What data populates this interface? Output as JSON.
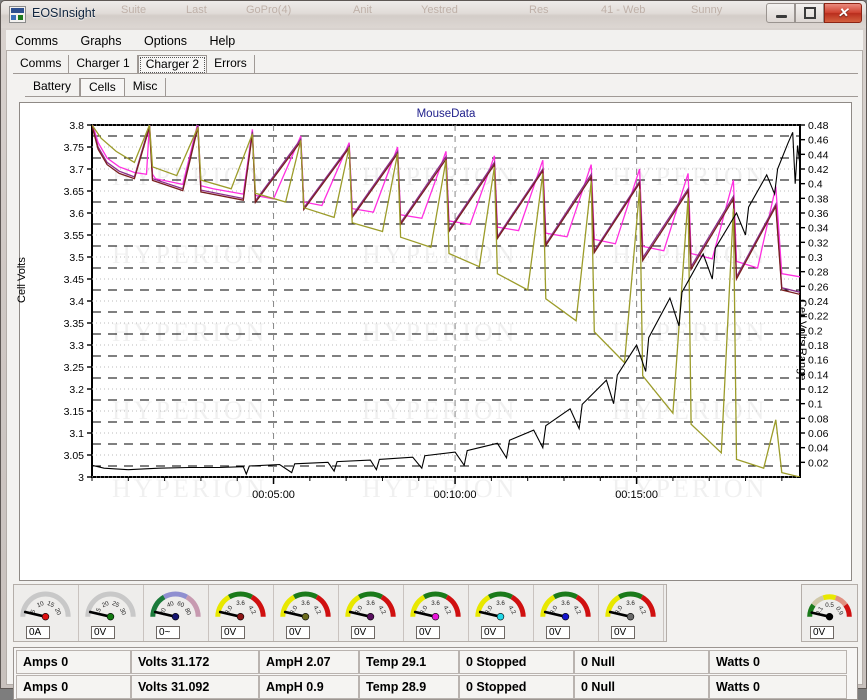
{
  "window": {
    "title": "EOSInsight",
    "ghost_labels": [
      "Suite",
      "Last",
      "GoPro(4)",
      "Anit",
      "Yestred",
      "Res",
      "41 - Web",
      "Sunny"
    ],
    "buttons": {
      "minimize": "minimize-button",
      "maximize": "maximize-button",
      "close": "✕"
    }
  },
  "menu": {
    "items": [
      "Comms",
      "Graphs",
      "Options",
      "Help"
    ]
  },
  "tabs_primary": {
    "items": [
      "Comms",
      "Charger 1",
      "Charger 2",
      "Errors"
    ],
    "selected": "Charger 2"
  },
  "tabs_secondary": {
    "items": [
      "Battery",
      "Cells",
      "Misc"
    ],
    "selected": "Cells"
  },
  "chart_data": {
    "type": "line",
    "title": "MouseData",
    "xlabel": "",
    "ylabel": "Cell Volts",
    "y2label": "Cell Volts Range",
    "ylim": [
      3,
      3.8
    ],
    "y2lim": [
      0,
      0.48
    ],
    "xlim": [
      0,
      1170
    ],
    "grid": true,
    "legend_position": "none",
    "watermark": "HYPERION",
    "xtick_labels": [
      "00:05:00",
      "00:10:00",
      "00:15:00"
    ],
    "xtick_values": [
      300,
      600,
      900
    ],
    "ytick_labels": [
      "3",
      "3.05",
      "3.1",
      "3.15",
      "3.2",
      "3.25",
      "3.3",
      "3.35",
      "3.4",
      "3.45",
      "3.5",
      "3.55",
      "3.6",
      "3.65",
      "3.7",
      "3.75",
      "3.8"
    ],
    "y2tick_labels": [
      "0.02",
      "0.04",
      "0.06",
      "0.08",
      "0.1",
      "0.12",
      "0.14",
      "0.16",
      "0.18",
      "0.2",
      "0.22",
      "0.24",
      "0.26",
      "0.28",
      "0.3",
      "0.32",
      "0.34",
      "0.36",
      "0.38",
      "0.4",
      "0.42",
      "0.44",
      "0.46",
      "0.48"
    ],
    "series": [
      {
        "name": "Cell Volts (magenta)",
        "color": "#ff2fe0",
        "axis": "left",
        "points": [
          [
            0,
            3.805
          ],
          [
            10,
            3.76
          ],
          [
            25,
            3.725
          ],
          [
            45,
            3.705
          ],
          [
            70,
            3.692
          ],
          [
            90,
            3.688
          ],
          [
            95,
            3.805
          ],
          [
            100,
            3.688
          ],
          [
            105,
            3.678
          ],
          [
            150,
            3.665
          ],
          [
            175,
            3.805
          ],
          [
            180,
            3.662
          ],
          [
            200,
            3.655
          ],
          [
            250,
            3.643
          ],
          [
            265,
            3.79
          ],
          [
            270,
            3.64
          ],
          [
            300,
            3.632
          ],
          [
            345,
            3.775
          ],
          [
            350,
            3.625
          ],
          [
            380,
            3.617
          ],
          [
            425,
            3.76
          ],
          [
            430,
            3.61
          ],
          [
            465,
            3.602
          ],
          [
            505,
            3.75
          ],
          [
            510,
            3.596
          ],
          [
            545,
            3.588
          ],
          [
            585,
            3.74
          ],
          [
            590,
            3.582
          ],
          [
            625,
            3.574
          ],
          [
            665,
            3.73
          ],
          [
            670,
            3.568
          ],
          [
            705,
            3.56
          ],
          [
            745,
            3.72
          ],
          [
            750,
            3.554
          ],
          [
            785,
            3.546
          ],
          [
            825,
            3.71
          ],
          [
            830,
            3.54
          ],
          [
            865,
            3.53
          ],
          [
            905,
            3.7
          ],
          [
            910,
            3.524
          ],
          [
            945,
            3.514
          ],
          [
            985,
            3.69
          ],
          [
            990,
            3.508
          ],
          [
            1025,
            3.496
          ],
          [
            1060,
            3.675
          ],
          [
            1065,
            3.49
          ],
          [
            1100,
            3.475
          ],
          [
            1130,
            3.66
          ],
          [
            1140,
            3.462
          ],
          [
            1170,
            3.455
          ]
        ]
      },
      {
        "name": "Cell Volts (purple)",
        "color": "#8b2f8b",
        "axis": "left",
        "points": [
          [
            0,
            3.8
          ],
          [
            10,
            3.75
          ],
          [
            25,
            3.715
          ],
          [
            45,
            3.695
          ],
          [
            70,
            3.682
          ],
          [
            95,
            3.8
          ],
          [
            100,
            3.678
          ],
          [
            150,
            3.655
          ],
          [
            175,
            3.8
          ],
          [
            180,
            3.652
          ],
          [
            250,
            3.633
          ],
          [
            265,
            3.785
          ],
          [
            270,
            3.628
          ],
          [
            345,
            3.768
          ],
          [
            350,
            3.612
          ],
          [
            425,
            3.752
          ],
          [
            430,
            3.594
          ],
          [
            505,
            3.74
          ],
          [
            510,
            3.578
          ],
          [
            585,
            3.728
          ],
          [
            590,
            3.562
          ],
          [
            665,
            3.715
          ],
          [
            670,
            3.546
          ],
          [
            745,
            3.7
          ],
          [
            750,
            3.53
          ],
          [
            825,
            3.688
          ],
          [
            830,
            3.514
          ],
          [
            905,
            3.672
          ],
          [
            910,
            3.498
          ],
          [
            985,
            3.655
          ],
          [
            990,
            3.478
          ],
          [
            1060,
            3.638
          ],
          [
            1065,
            3.455
          ],
          [
            1130,
            3.62
          ],
          [
            1140,
            3.43
          ],
          [
            1170,
            3.42
          ]
        ]
      },
      {
        "name": "Cell Volts (dark red)",
        "color": "#7a2020",
        "axis": "left",
        "points": [
          [
            0,
            3.798
          ],
          [
            10,
            3.745
          ],
          [
            25,
            3.71
          ],
          [
            45,
            3.69
          ],
          [
            70,
            3.678
          ],
          [
            95,
            3.795
          ],
          [
            100,
            3.674
          ],
          [
            150,
            3.651
          ],
          [
            175,
            3.795
          ],
          [
            180,
            3.648
          ],
          [
            250,
            3.629
          ],
          [
            265,
            3.78
          ],
          [
            270,
            3.624
          ],
          [
            345,
            3.763
          ],
          [
            350,
            3.608
          ],
          [
            425,
            3.748
          ],
          [
            430,
            3.59
          ],
          [
            505,
            3.735
          ],
          [
            510,
            3.574
          ],
          [
            585,
            3.722
          ],
          [
            590,
            3.558
          ],
          [
            665,
            3.71
          ],
          [
            670,
            3.542
          ],
          [
            745,
            3.696
          ],
          [
            750,
            3.526
          ],
          [
            825,
            3.682
          ],
          [
            830,
            3.51
          ],
          [
            905,
            3.668
          ],
          [
            910,
            3.492
          ],
          [
            985,
            3.65
          ],
          [
            990,
            3.472
          ],
          [
            1060,
            3.632
          ],
          [
            1065,
            3.45
          ],
          [
            1130,
            3.615
          ],
          [
            1140,
            3.425
          ],
          [
            1170,
            3.415
          ]
        ]
      },
      {
        "name": "Cell Volts (olive/weak cell)",
        "color": "#9c9c2a",
        "axis": "left",
        "points": [
          [
            0,
            3.8
          ],
          [
            15,
            3.77
          ],
          [
            40,
            3.74
          ],
          [
            70,
            3.715
          ],
          [
            95,
            3.8
          ],
          [
            100,
            3.705
          ],
          [
            140,
            3.685
          ],
          [
            175,
            3.795
          ],
          [
            180,
            3.675
          ],
          [
            230,
            3.655
          ],
          [
            265,
            3.78
          ],
          [
            270,
            3.645
          ],
          [
            320,
            3.625
          ],
          [
            345,
            3.765
          ],
          [
            350,
            3.612
          ],
          [
            400,
            3.59
          ],
          [
            425,
            3.75
          ],
          [
            430,
            3.578
          ],
          [
            480,
            3.558
          ],
          [
            505,
            3.735
          ],
          [
            510,
            3.545
          ],
          [
            560,
            3.522
          ],
          [
            585,
            3.72
          ],
          [
            590,
            3.508
          ],
          [
            640,
            3.478
          ],
          [
            665,
            3.705
          ],
          [
            670,
            3.462
          ],
          [
            720,
            3.425
          ],
          [
            745,
            3.69
          ],
          [
            750,
            3.405
          ],
          [
            800,
            3.355
          ],
          [
            825,
            3.672
          ],
          [
            830,
            3.33
          ],
          [
            880,
            3.26
          ],
          [
            905,
            3.655
          ],
          [
            910,
            3.23
          ],
          [
            960,
            3.145
          ],
          [
            985,
            3.635
          ],
          [
            990,
            3.12
          ],
          [
            1040,
            3.055
          ],
          [
            1060,
            3.61
          ],
          [
            1065,
            3.04
          ],
          [
            1110,
            3.02
          ],
          [
            1130,
            3.13
          ],
          [
            1140,
            3.01
          ],
          [
            1170,
            3.0
          ]
        ]
      },
      {
        "name": "Cell Volts Range",
        "color": "#000000",
        "axis": "right",
        "points": [
          [
            0,
            0.016
          ],
          [
            20,
            0.012
          ],
          [
            60,
            0.01
          ],
          [
            110,
            0.012
          ],
          [
            160,
            0.013
          ],
          [
            210,
            0.013
          ],
          [
            250,
            0.014
          ],
          [
            255,
            0.004
          ],
          [
            260,
            0.015
          ],
          [
            310,
            0.017
          ],
          [
            330,
            0.006
          ],
          [
            335,
            0.018
          ],
          [
            390,
            0.02
          ],
          [
            400,
            0.008
          ],
          [
            405,
            0.021
          ],
          [
            460,
            0.023
          ],
          [
            470,
            0.01
          ],
          [
            475,
            0.024
          ],
          [
            530,
            0.027
          ],
          [
            545,
            0.012
          ],
          [
            550,
            0.029
          ],
          [
            600,
            0.034
          ],
          [
            615,
            0.016
          ],
          [
            620,
            0.036
          ],
          [
            670,
            0.046
          ],
          [
            685,
            0.026
          ],
          [
            690,
            0.05
          ],
          [
            730,
            0.064
          ],
          [
            745,
            0.04
          ],
          [
            750,
            0.07
          ],
          [
            790,
            0.093
          ],
          [
            805,
            0.066
          ],
          [
            810,
            0.099
          ],
          [
            850,
            0.132
          ],
          [
            862,
            0.1
          ],
          [
            868,
            0.139
          ],
          [
            900,
            0.18
          ],
          [
            915,
            0.144
          ],
          [
            920,
            0.19
          ],
          [
            955,
            0.244
          ],
          [
            970,
            0.206
          ],
          [
            975,
            0.252
          ],
          [
            1010,
            0.304
          ],
          [
            1025,
            0.27
          ],
          [
            1030,
            0.312
          ],
          [
            1065,
            0.36
          ],
          [
            1080,
            0.33
          ],
          [
            1085,
            0.368
          ],
          [
            1115,
            0.412
          ],
          [
            1128,
            0.386
          ],
          [
            1133,
            0.42
          ],
          [
            1150,
            0.455
          ],
          [
            1158,
            0.47
          ],
          [
            1162,
            0.4
          ],
          [
            1166,
            0.452
          ],
          [
            1170,
            0.425
          ]
        ]
      }
    ]
  },
  "gauges": {
    "items": [
      {
        "name": "gauge-amps",
        "value": "0A",
        "scale_labels": [
          "5",
          "10",
          "15",
          "20"
        ],
        "hub_color": "#dd1111",
        "arc_colors": [
          "#c8c8c8"
        ]
      },
      {
        "name": "gauge-volts",
        "value": "0V",
        "scale_labels": [
          "15",
          "20",
          "25",
          "30"
        ],
        "hub_color": "#117a11",
        "arc_colors": [
          "#c8c8c8"
        ]
      },
      {
        "name": "gauge-temp",
        "value": "0~",
        "scale_labels": [
          "20",
          "40",
          "60",
          "80"
        ],
        "hub_color": "#161670",
        "arc_colors": [
          "#1a7a3a",
          "#8f8fd0",
          "#c79ab0"
        ]
      },
      {
        "name": "gauge-cell-1",
        "value": "0V",
        "scale_labels": [
          "3.0",
          "3.6",
          "4.2"
        ],
        "hub_color": "#8e1616",
        "arc_colors": [
          "#e8e800",
          "#1a7a1a",
          "#d01010"
        ]
      },
      {
        "name": "gauge-cell-2",
        "value": "0V",
        "scale_labels": [
          "3.0",
          "3.6",
          "4.2"
        ],
        "hub_color": "#6b6b1c",
        "arc_colors": [
          "#e8e800",
          "#1a7a1a",
          "#d01010"
        ]
      },
      {
        "name": "gauge-cell-3",
        "value": "0V",
        "scale_labels": [
          "3.0",
          "3.6",
          "4.2"
        ],
        "hub_color": "#5a1060",
        "arc_colors": [
          "#e8e800",
          "#1a7a1a",
          "#d01010"
        ]
      },
      {
        "name": "gauge-cell-4",
        "value": "0V",
        "scale_labels": [
          "3.0",
          "3.6",
          "4.2"
        ],
        "hub_color": "#e816d8",
        "arc_colors": [
          "#e8e800",
          "#1a7a1a",
          "#d01010"
        ]
      },
      {
        "name": "gauge-cell-5",
        "value": "0V",
        "scale_labels": [
          "3.0",
          "3.6",
          "4.2"
        ],
        "hub_color": "#22d8e8",
        "arc_colors": [
          "#e8e800",
          "#1a7a1a",
          "#d01010"
        ]
      },
      {
        "name": "gauge-cell-6",
        "value": "0V",
        "scale_labels": [
          "3.0",
          "3.6",
          "4.2"
        ],
        "hub_color": "#1616cc",
        "arc_colors": [
          "#e8e800",
          "#1a7a1a",
          "#d01010"
        ]
      },
      {
        "name": "gauge-cell-7",
        "value": "0V",
        "scale_labels": [
          "3.0",
          "3.6",
          "4.2"
        ],
        "hub_color": "#6a6a6a",
        "arc_colors": [
          "#e8e800",
          "#1a7a1a",
          "#d01010"
        ]
      }
    ],
    "right_gauge": {
      "name": "gauge-range",
      "value": "0V",
      "scale_labels": [
        "0.1",
        "0.5",
        "0.9"
      ],
      "hub_color": "#000000",
      "arc_colors": [
        "#1a7a1a",
        "#cfc8a8",
        "#e8e800",
        "#e09080",
        "#d01010"
      ]
    }
  },
  "status": {
    "rows": [
      [
        "Amps 0",
        "Volts 31.172",
        "AmpH 2.07",
        "Temp 29.1",
        "0 Stopped",
        "0 Null",
        "Watts 0"
      ],
      [
        "Amps 0",
        "Volts 31.092",
        "AmpH 0.9",
        "Temp 28.9",
        "0 Stopped",
        "0 Null",
        "Watts 0"
      ]
    ]
  }
}
